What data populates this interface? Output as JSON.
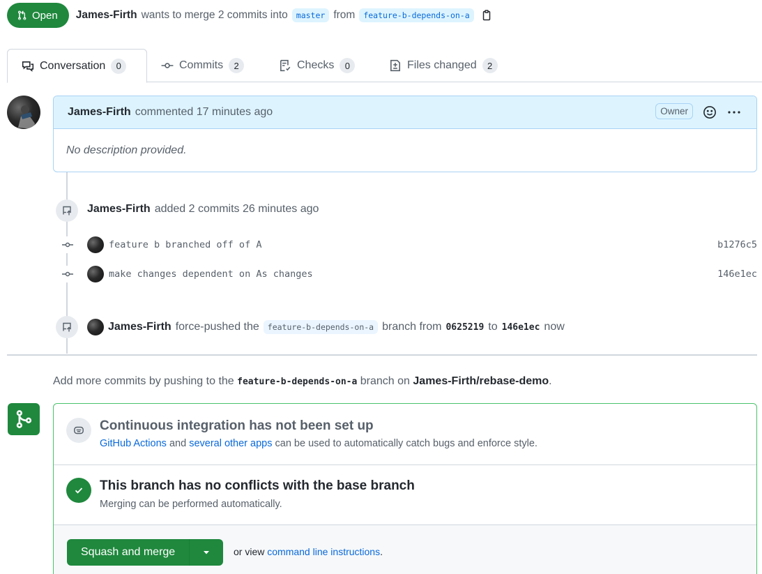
{
  "pr_state": {
    "label": "Open",
    "color": "#1f883d"
  },
  "summary": {
    "author": "James-Firth",
    "text_before": "wants to merge 2 commits into",
    "base_branch": "master",
    "from_text": "from",
    "head_branch": "feature-b-depends-on-a"
  },
  "tabs": [
    {
      "label": "Conversation",
      "count": "0",
      "icon": "comment-discussion-icon"
    },
    {
      "label": "Commits",
      "count": "2",
      "icon": "git-commit-icon"
    },
    {
      "label": "Checks",
      "count": "0",
      "icon": "checklist-icon"
    },
    {
      "label": "Files changed",
      "count": "2",
      "icon": "file-diff-icon"
    }
  ],
  "comment": {
    "author": "James-Firth",
    "meta": "commented 17 minutes ago",
    "role": "Owner",
    "body": "No description provided."
  },
  "timeline": {
    "added": {
      "author": "James-Firth",
      "text": "added 2 commits 26 minutes ago"
    },
    "commits": [
      {
        "message": "feature b branched off of A",
        "sha": "b1276c5"
      },
      {
        "message": "make changes dependent on As changes",
        "sha": "146e1ec"
      }
    ],
    "force_push": {
      "author": "James-Firth",
      "text_before": "force-pushed the",
      "branch": "feature-b-depends-on-a",
      "text_mid": "branch from",
      "from_sha": "0625219",
      "to_text": "to",
      "to_sha": "146e1ec",
      "time": "now"
    }
  },
  "hint": {
    "before": "Add more commits by pushing to the",
    "branch": "feature-b-depends-on-a",
    "mid": "branch on",
    "repo": "James-Firth/rebase-demo",
    "end": "."
  },
  "merge_box": {
    "ci": {
      "title": "Continuous integration has not been set up",
      "link1": "GitHub Actions",
      "and": "and",
      "link2": "several other apps",
      "rest": "can be used to automatically catch bugs and enforce style."
    },
    "conflicts": {
      "title": "This branch has no conflicts with the base branch",
      "sub": "Merging can be performed automatically."
    },
    "action": {
      "button": "Squash and merge",
      "or_view": "or view",
      "link": "command line instructions",
      "end": "."
    }
  }
}
